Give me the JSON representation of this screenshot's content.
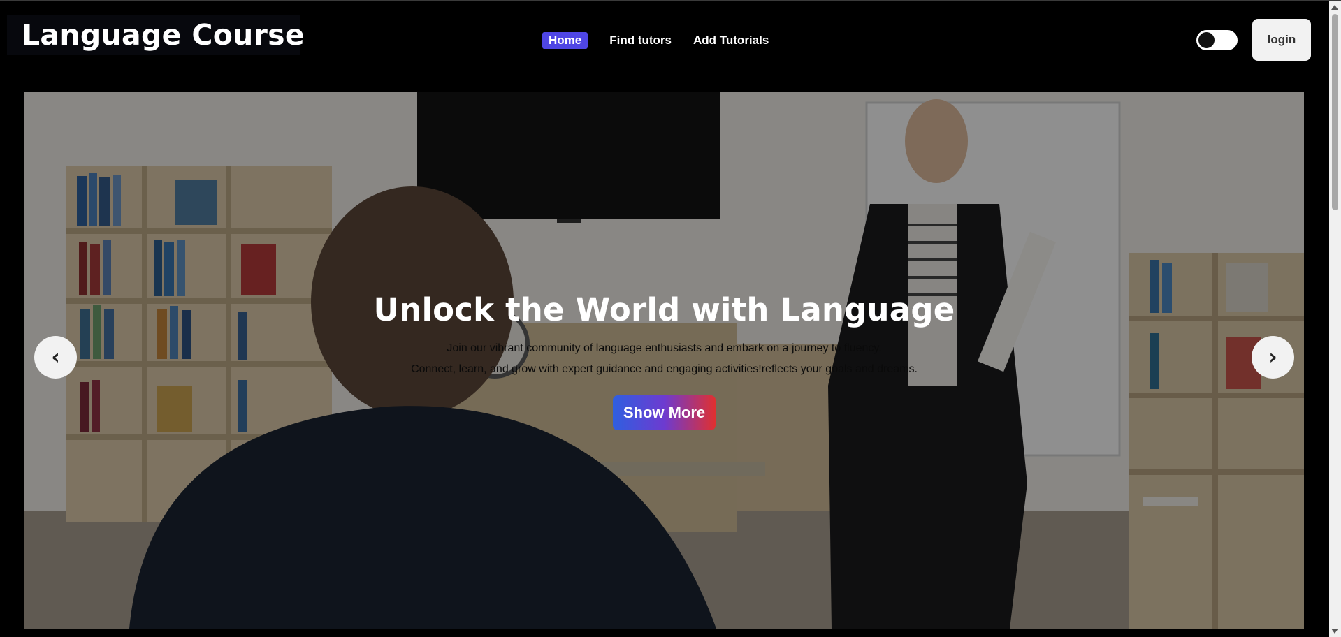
{
  "brand": {
    "title": "Language Course"
  },
  "nav": {
    "items": [
      {
        "label": "Home",
        "active": true
      },
      {
        "label": "Find tutors",
        "active": false
      },
      {
        "label": "Add Tutorials",
        "active": false
      }
    ]
  },
  "theme_toggle": {
    "state": "off"
  },
  "auth": {
    "login_label": "login"
  },
  "hero": {
    "title": "Unlock the World with Language",
    "description_line1": "Join our vibrant community of language enthusiasts and embark on a journey to fluency.",
    "description_line2": "Connect, learn, and grow with expert guidance and engaging activities!reflects your goals and dreams.",
    "cta_label": "Show More",
    "prev_icon": "‹",
    "next_icon": "›"
  },
  "colors": {
    "accent": "#4f46e5",
    "background": "#000000",
    "cta_gradient": [
      "#2f5fe0",
      "#e03030"
    ]
  }
}
